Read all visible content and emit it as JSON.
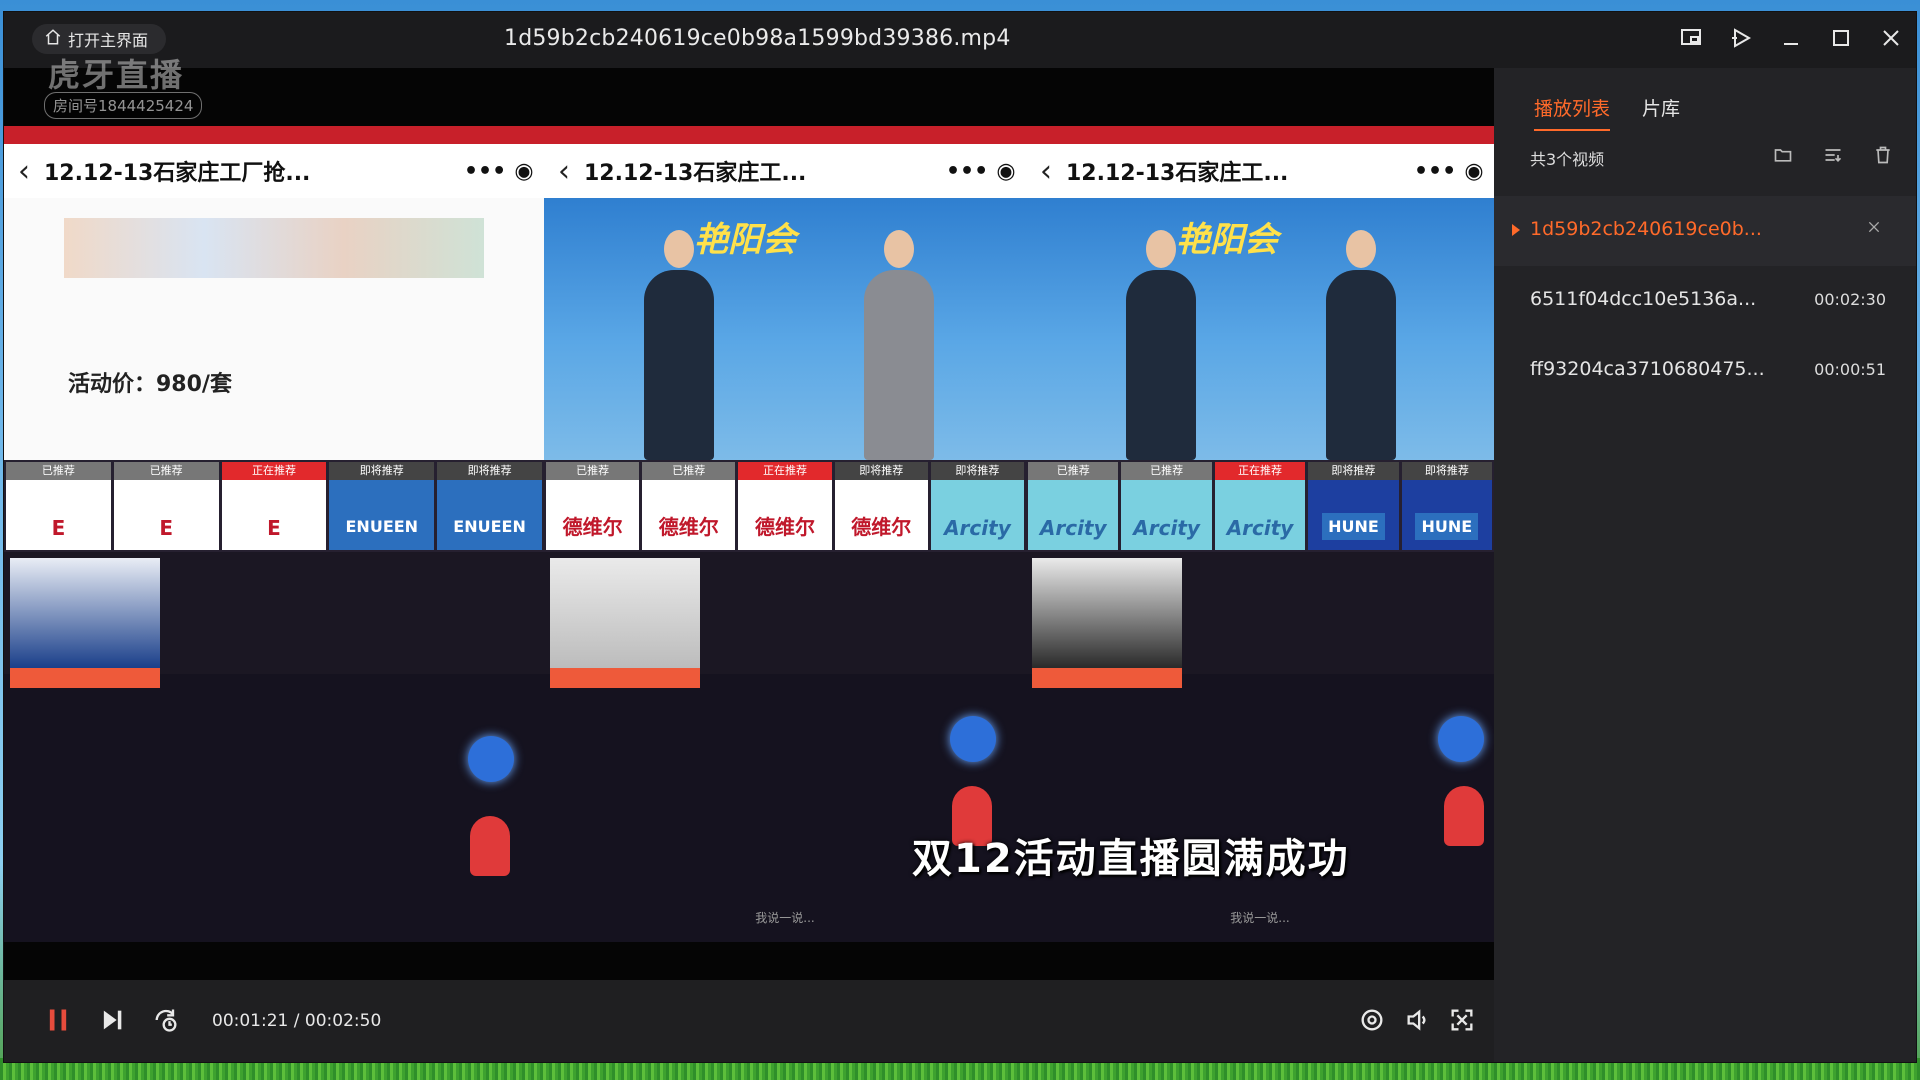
{
  "window": {
    "home_label": "打开主界面",
    "title": "1d59b2cb240619ce0b98a1599bd39386.mp4"
  },
  "overlay": {
    "watermark": "虎牙直播",
    "room": "房间号1844425424"
  },
  "video": {
    "subtitle": "双12活动直播圆满成功",
    "phones": [
      {
        "title": "12.12-13石家庄工厂抢...",
        "price": "活动价：980/套"
      },
      {
        "title": "12.12-13石家庄工...",
        "banner": "艳阳会"
      },
      {
        "title": "12.12-13石家庄工...",
        "banner": "艳阳会"
      }
    ],
    "tags": {
      "done": "已推荐",
      "now": "正在推荐",
      "next": "即将推荐"
    },
    "input_placeholder": "我说一说..."
  },
  "player": {
    "current_time": "00:01:21",
    "separator": " / ",
    "total_time": "00:02:50",
    "progress": 0.476
  },
  "sidebar": {
    "tabs": [
      {
        "label": "播放列表",
        "active": true
      },
      {
        "label": "片库",
        "active": false
      }
    ],
    "count_label": "共3个视频",
    "items": [
      {
        "name": "1d59b2cb240619ce0b...",
        "duration": "",
        "active": true
      },
      {
        "name": "6511f04dcc10e5136a...",
        "duration": "00:02:30",
        "active": false
      },
      {
        "name": "ff93204ca3710680475...",
        "duration": "00:00:51",
        "active": false
      }
    ]
  },
  "colors": {
    "accent": "#ff6a2a",
    "titlebar": "#1b1b1d",
    "sidebar": "#232326",
    "play_pause": "#e74c3c"
  }
}
